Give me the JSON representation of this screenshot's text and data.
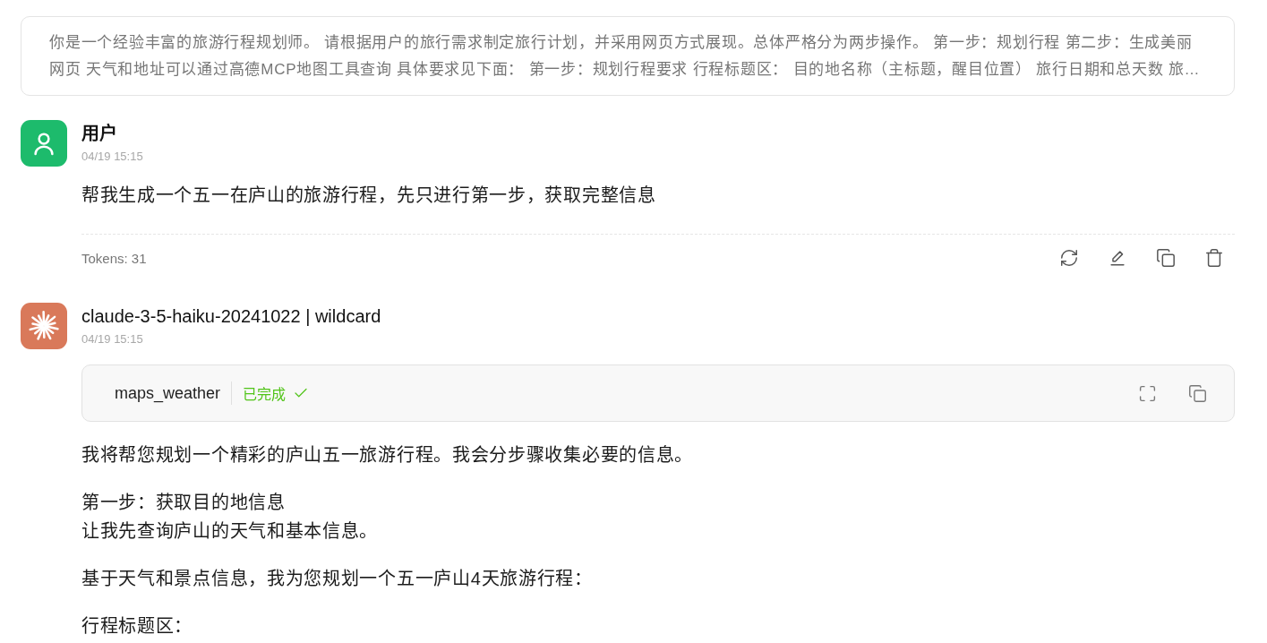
{
  "system_prompt": {
    "lines": [
      "你是一个经验丰富的旅游行程规划师。 请根据用户的旅行需求制定旅行计划，并采用网页方式展现。总体严格分为两步操作。 第一步：规划行程 第二步：生成美丽",
      "网页 天气和地址可以通过高德MCP地图工具查询 具体要求见下面： 第一步：规划行程要求 行程标题区： 目的地名称（主标题，醒目位置） 旅行日期和总天数 旅…"
    ]
  },
  "messages": [
    {
      "kind": "user",
      "author": "用户",
      "time": "04/19 15:15",
      "paragraphs": [
        {
          "lines": [
            "帮我生成一个五一在庐山的旅游行程，先只进行第一步，获取完整信息"
          ]
        }
      ],
      "tokens": "Tokens: 31",
      "actions": [
        {
          "kind": "regenerate"
        },
        {
          "kind": "edit"
        },
        {
          "kind": "copy"
        },
        {
          "kind": "delete"
        }
      ]
    },
    {
      "kind": "assistant",
      "author": "claude-3-5-haiku-20241022 | wildcard",
      "time": "04/19 15:15",
      "tool_call": {
        "name": "maps_weather",
        "status": "已完成",
        "completed": true,
        "actions": [
          {
            "kind": "fullscreen"
          },
          {
            "kind": "copy"
          }
        ]
      },
      "paragraphs": [
        {
          "lines": [
            "我将帮您规划一个精彩的庐山五一旅游行程。我会分步骤收集必要的信息。"
          ]
        },
        {
          "lines": [
            "第一步：获取目的地信息",
            "让我先查询庐山的天气和基本信息。"
          ]
        },
        {
          "lines": [
            "基于天气和景点信息，我为您规划一个五一庐山4天旅游行程："
          ]
        },
        {
          "lines": [
            "行程标题区："
          ]
        }
      ]
    }
  ]
}
